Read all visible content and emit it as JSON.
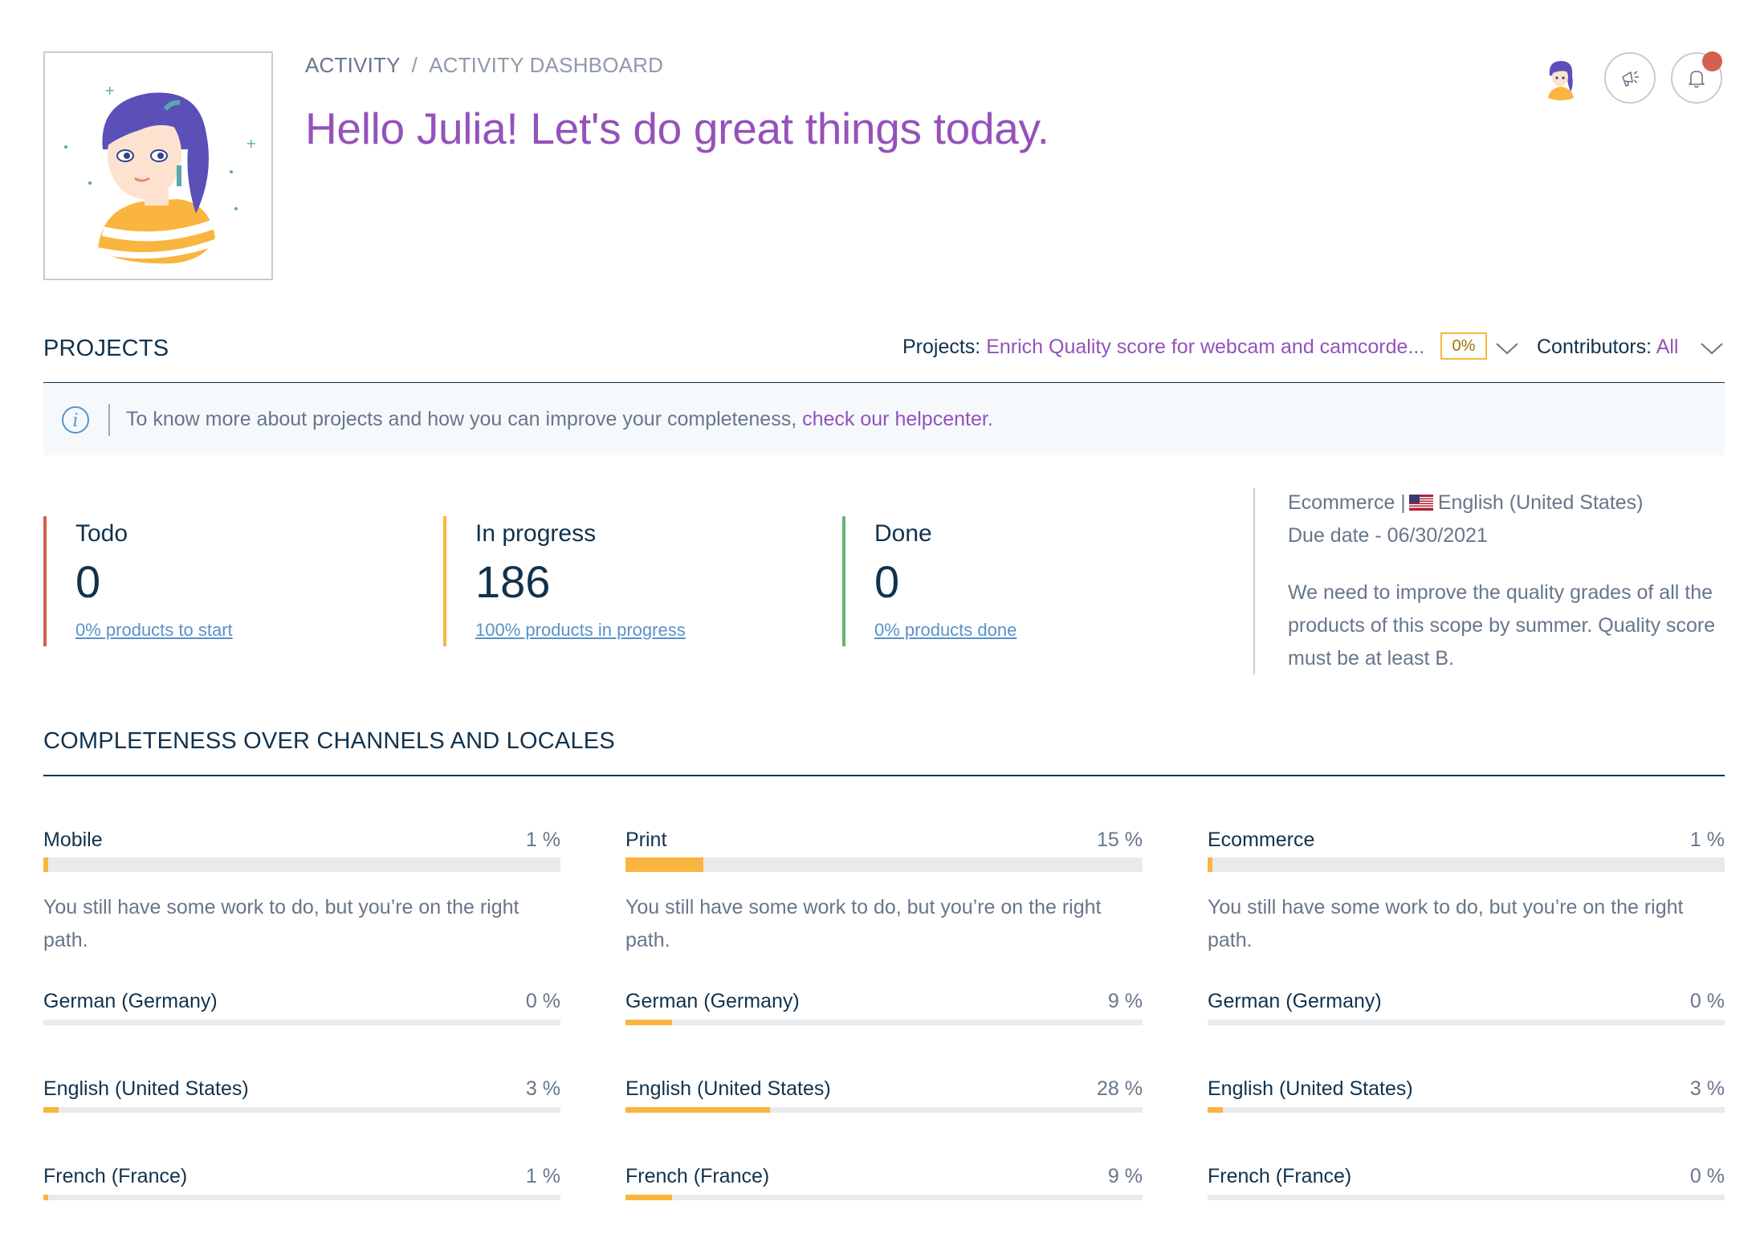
{
  "breadcrumb": {
    "first": "ACTIVITY",
    "separator": "/",
    "second": "ACTIVITY DASHBOARD"
  },
  "greeting": "Hello Julia! Let's do great things today.",
  "notification_dot_color": "#d4604f",
  "projects": {
    "title": "PROJECTS",
    "filter_label": "Projects:",
    "filter_value": "Enrich Quality score for webcam and camcorde...",
    "filter_percent": "0%",
    "contributors_label": "Contributors:",
    "contributors_value": "All"
  },
  "info": {
    "text": "To know more about projects and how you can improve your completeness,",
    "link": "check our helpcenter."
  },
  "stats": [
    {
      "label": "Todo",
      "value": "0",
      "link": "0% products to start",
      "color": "#d4604f"
    },
    {
      "label": "In progress",
      "value": "186",
      "link": "100% products in progress",
      "color": "#f9b53f"
    },
    {
      "label": "Done",
      "value": "0",
      "link": "0% products done",
      "color": "#67b373"
    }
  ],
  "project_info": {
    "channel": "Ecommerce |",
    "locale": "English (United States)",
    "due_date": "Due date - 06/30/2021",
    "description": "We need to improve the quality grades of all the products of this scope by summer. Quality score must be at least B."
  },
  "completeness": {
    "title": "COMPLETENESS OVER CHANNELS AND LOCALES",
    "message": "You still have some work to do, but you’re on the right path.",
    "channels": [
      {
        "name": "Mobile",
        "percent_label": "1 %",
        "percent": 1,
        "locales": [
          {
            "name": "German (Germany)",
            "percent_label": "0 %",
            "percent": 0
          },
          {
            "name": "English (United States)",
            "percent_label": "3 %",
            "percent": 3
          },
          {
            "name": "French (France)",
            "percent_label": "1 %",
            "percent": 1
          }
        ]
      },
      {
        "name": "Print",
        "percent_label": "15 %",
        "percent": 15,
        "locales": [
          {
            "name": "German (Germany)",
            "percent_label": "9 %",
            "percent": 9
          },
          {
            "name": "English (United States)",
            "percent_label": "28 %",
            "percent": 28
          },
          {
            "name": "French (France)",
            "percent_label": "9 %",
            "percent": 9
          }
        ]
      },
      {
        "name": "Ecommerce",
        "percent_label": "1 %",
        "percent": 1,
        "locales": [
          {
            "name": "German (Germany)",
            "percent_label": "0 %",
            "percent": 0
          },
          {
            "name": "English (United States)",
            "percent_label": "3 %",
            "percent": 3
          },
          {
            "name": "French (France)",
            "percent_label": "0 %",
            "percent": 0
          }
        ]
      }
    ]
  }
}
